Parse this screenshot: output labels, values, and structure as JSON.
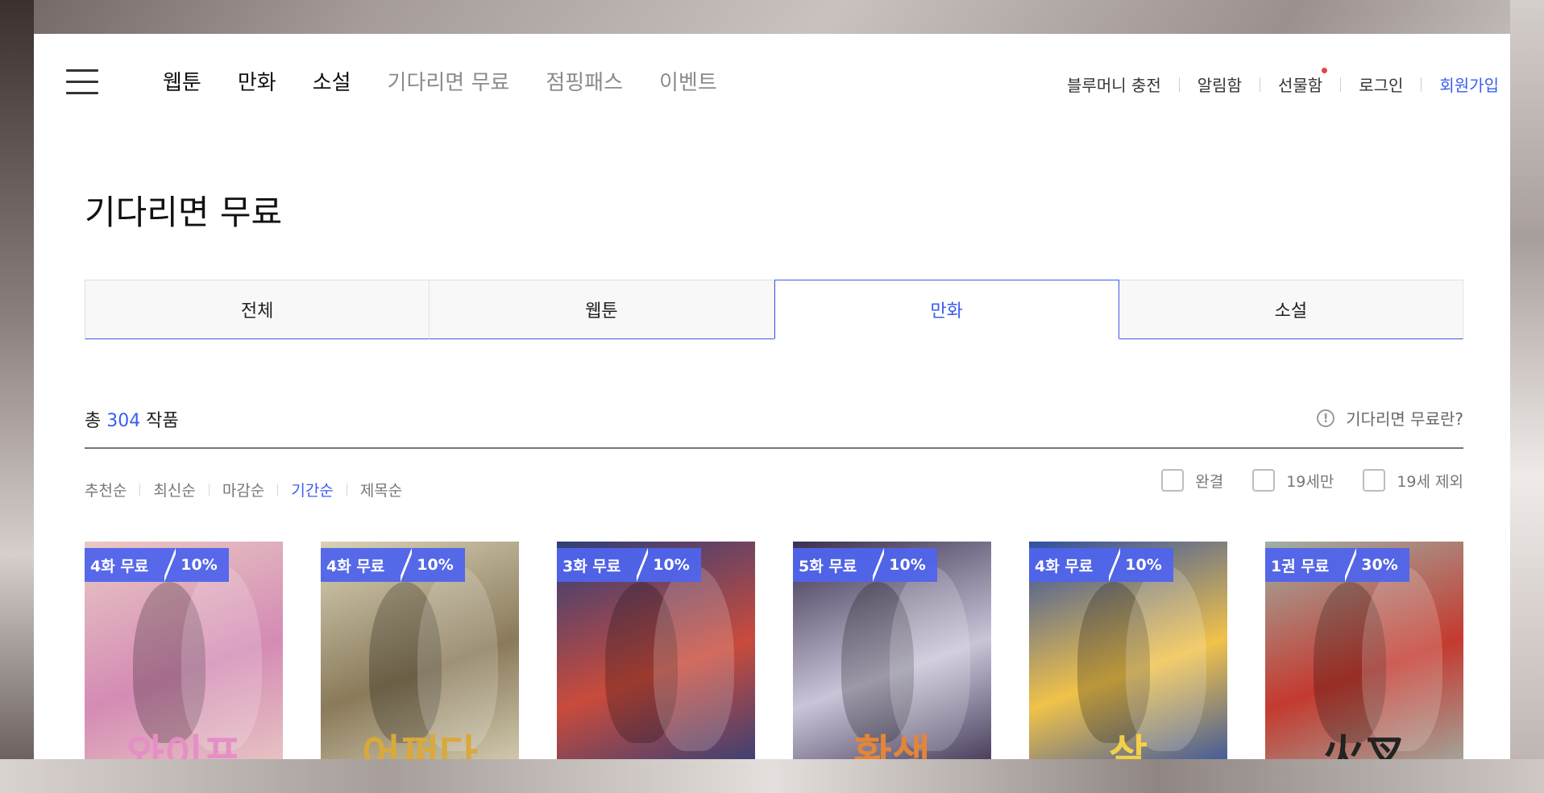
{
  "header": {
    "nav": [
      {
        "label": "웹툰",
        "style": "dark"
      },
      {
        "label": "만화",
        "style": "dark"
      },
      {
        "label": "소설",
        "style": "dark"
      },
      {
        "label": "기다리면 무료",
        "style": "light"
      },
      {
        "label": "점핑패스",
        "style": "light"
      },
      {
        "label": "이벤트",
        "style": "light"
      }
    ],
    "util": {
      "charge": "블루머니 충전",
      "notice": "알림함",
      "gift": "선물함",
      "login": "로그인",
      "signup": "회원가입"
    }
  },
  "page_title": "기다리면 무료",
  "tabs": [
    {
      "label": "전체",
      "active": false
    },
    {
      "label": "웹툰",
      "active": false
    },
    {
      "label": "만화",
      "active": true
    },
    {
      "label": "소설",
      "active": false
    }
  ],
  "summary": {
    "prefix": "총",
    "count": "304",
    "suffix": "작품",
    "help": "기다리면 무료란?"
  },
  "sort_options": [
    {
      "label": "추천순",
      "active": false
    },
    {
      "label": "최신순",
      "active": false
    },
    {
      "label": "마감순",
      "active": false
    },
    {
      "label": "기간순",
      "active": true
    },
    {
      "label": "제목순",
      "active": false
    }
  ],
  "filters": [
    {
      "label": "완결",
      "checked": false
    },
    {
      "label": "19세만",
      "checked": false
    },
    {
      "label": "19세 제외",
      "checked": false
    }
  ],
  "cards": [
    {
      "free": "4화 무료",
      "discount": "10%",
      "cover_text": "와이프",
      "bg": "#e9c9c4",
      "accent": "#d48bb4",
      "text_color": "#e58fc6"
    },
    {
      "free": "4화 무료",
      "discount": "10%",
      "cover_text": "어쩌다",
      "bg": "#d9d2b8",
      "accent": "#8a7a5a",
      "text_color": "#d9a93a"
    },
    {
      "free": "3화 무료",
      "discount": "10%",
      "cover_text": "",
      "bg": "#2e3f7a",
      "accent": "#c94b3c",
      "text_color": "#ffffff"
    },
    {
      "free": "5화 무료",
      "discount": "10%",
      "cover_text": "환생",
      "bg": "#3a2f4e",
      "accent": "#c9c4d8",
      "text_color": "#e2863a"
    },
    {
      "free": "4화 무료",
      "discount": "10%",
      "cover_text": "살",
      "bg": "#2f4fa3",
      "accent": "#f0c24a",
      "text_color": "#f3d04a"
    },
    {
      "free": "1권 무료",
      "discount": "30%",
      "cover_text": "火叉",
      "bg": "#9fb0a6",
      "accent": "#c43a2f",
      "text_color": "#222222"
    }
  ],
  "colors": {
    "accent": "#3b5cf0",
    "badge": "#4f64ec"
  }
}
